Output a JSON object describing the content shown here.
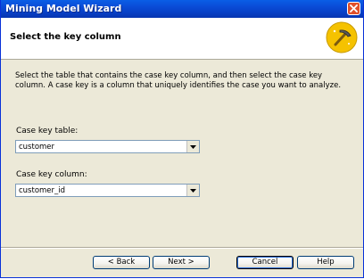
{
  "window": {
    "title": "Mining Model Wizard"
  },
  "header": {
    "title": "Select the key column"
  },
  "content": {
    "description": "Select the table that contains the case key column, and then select the case key column. A case key is a column that uniquely identifies the case you want to analyze.",
    "case_key_table": {
      "label": "Case key table:",
      "value": "customer"
    },
    "case_key_column": {
      "label": "Case key column:",
      "value": "customer_id"
    }
  },
  "buttons": {
    "back": "< Back",
    "next": "Next >",
    "cancel": "Cancel",
    "help": "Help"
  },
  "colors": {
    "titlebar": "#0a4dd8",
    "close_button": "#e0502a",
    "dialog_background": "#ece9d8",
    "wizard_icon_circle": "#f5c200"
  },
  "icons": {
    "close": "close-icon",
    "wizard": "mining-wand-icon",
    "dropdown": "chevron-down-icon"
  }
}
